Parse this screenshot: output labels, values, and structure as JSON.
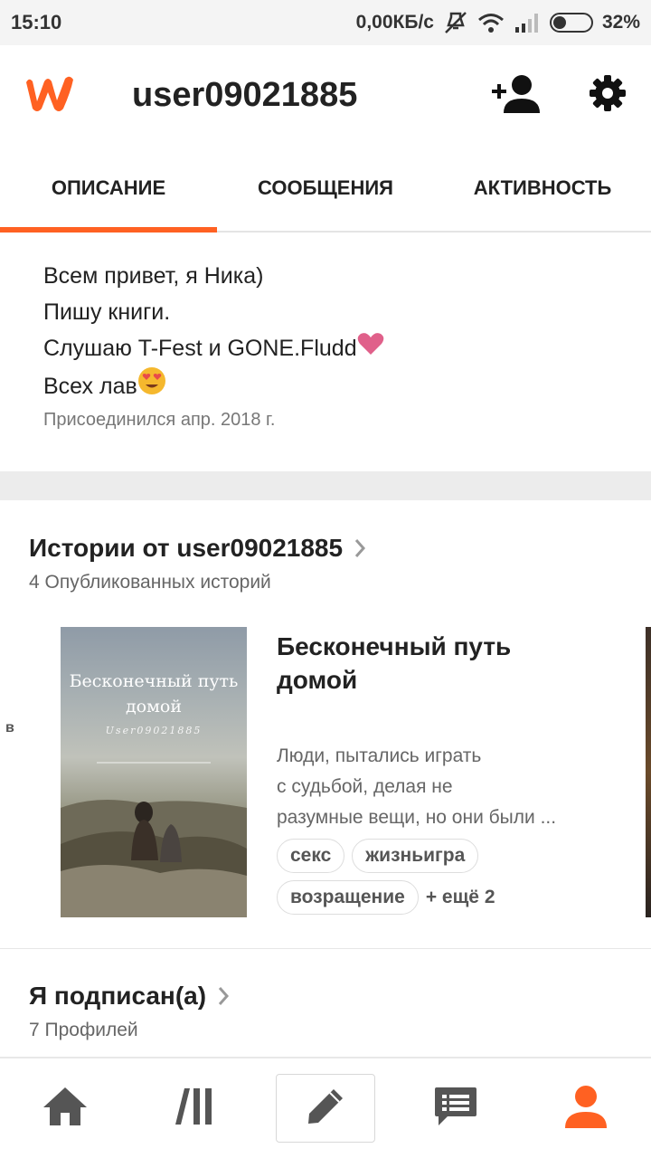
{
  "status_bar": {
    "time": "15:10",
    "network_speed": "0,00КБ/с",
    "battery": "32%",
    "battery_level": 0.32
  },
  "app_bar": {
    "username": "user09021885"
  },
  "tabs": [
    {
      "label": "ОПИСАНИЕ",
      "active": true
    },
    {
      "label": "СООБЩЕНИЯ",
      "active": false
    },
    {
      "label": "АКТИВНОСТЬ",
      "active": false
    }
  ],
  "bio": {
    "lines": [
      "Всем привет, я Ника)",
      "Пишу книги.",
      "Слушаю T-Fest и GONE.Fludd",
      "Всех лав"
    ],
    "joined": "Присоединился апр. 2018 г."
  },
  "stories": {
    "title": "Истории от user09021885",
    "count": "4 Опубликованных историй",
    "left_peek": "в",
    "items": [
      {
        "cover_title": "Бесконечный путь домой",
        "cover_author": "User09021885",
        "title_line1": "Бесконечный путь",
        "title_line2": "домой",
        "desc_line1": "Люди, пытались играть",
        "desc_line2": "с судьбой, делая не",
        "desc_line3": "разумные вещи, но они были ...",
        "tags": [
          "секс",
          "жизньигра",
          "возращение"
        ],
        "more": "+ ещё 2"
      }
    ]
  },
  "following": {
    "title": "Я подписан(а)",
    "count": "7 Профилей"
  },
  "colors": {
    "accent": "#ff6122",
    "text": "#222222",
    "muted": "#666666"
  },
  "icons": {
    "app_bar": [
      "wattpad-logo-icon",
      "add-user-icon",
      "settings-gear-icon"
    ],
    "bottom_nav": [
      "home-icon",
      "library-icon",
      "pencil-icon",
      "messages-icon",
      "profile-icon"
    ]
  }
}
